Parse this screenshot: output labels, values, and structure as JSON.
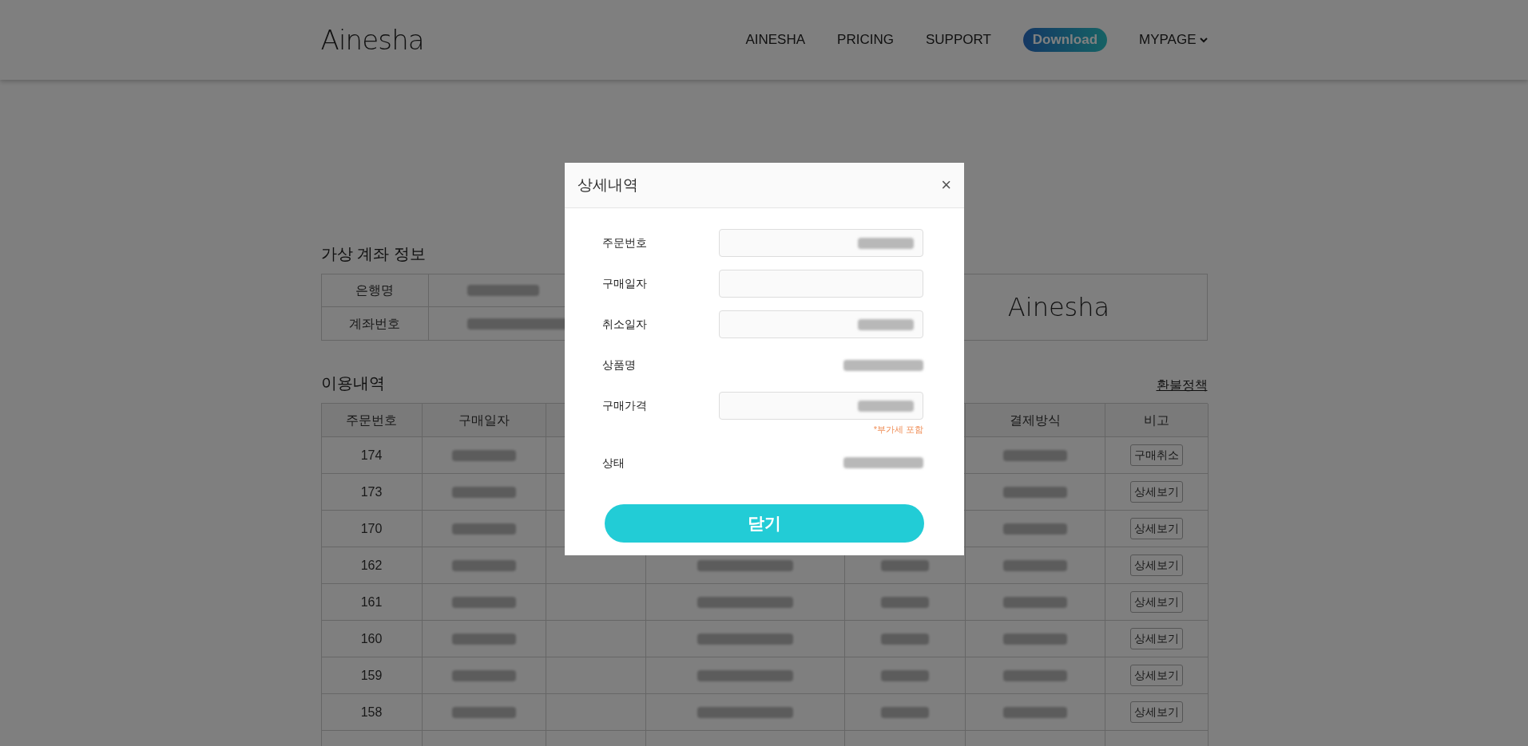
{
  "header": {
    "logo": "Ainesha",
    "nav": [
      {
        "label": "AINESHA",
        "kind": "link"
      },
      {
        "label": "PRICING",
        "kind": "link"
      },
      {
        "label": "SUPPORT",
        "kind": "link"
      },
      {
        "label": "Download",
        "kind": "pill"
      },
      {
        "label": "MYPAGE",
        "kind": "dropdown"
      }
    ]
  },
  "account": {
    "title": "가상 계좌 정보",
    "rows": [
      {
        "label": "은행명"
      },
      {
        "label": "계좌번호"
      }
    ],
    "logo": "Ainesha"
  },
  "history": {
    "title": "이용내역",
    "link": "환불정책",
    "columns": [
      {
        "label": "주문번호"
      },
      {
        "label": "구매일자"
      },
      {},
      {},
      {},
      {
        "label": "결제방식"
      },
      {
        "label": "비고"
      }
    ],
    "rows": [
      {
        "order_no": "174",
        "action": "구매취소"
      },
      {
        "order_no": "173",
        "action": "상세보기"
      },
      {
        "order_no": "170",
        "action": "상세보기"
      },
      {
        "order_no": "162",
        "action": "상세보기"
      },
      {
        "order_no": "161",
        "action": "상세보기"
      },
      {
        "order_no": "160",
        "action": "상세보기"
      },
      {
        "order_no": "159",
        "action": "상세보기"
      },
      {
        "order_no": "158",
        "action": "상세보기"
      }
    ]
  },
  "modal": {
    "title": "상세내역",
    "close": "×",
    "fields": [
      {
        "label": "주문번호",
        "kind": "input",
        "value_hidden": true
      },
      {
        "label": "구매일자",
        "kind": "input",
        "value_hidden": false
      },
      {
        "label": "취소일자",
        "kind": "input",
        "value_hidden": true
      },
      {
        "label": "상품명",
        "kind": "text",
        "value_hidden": true
      },
      {
        "label": "구매가격",
        "kind": "input",
        "value_hidden": true,
        "note": "*부가세 포함"
      },
      {
        "label": "상태",
        "kind": "text",
        "value_hidden": true
      }
    ],
    "button": "닫기"
  }
}
